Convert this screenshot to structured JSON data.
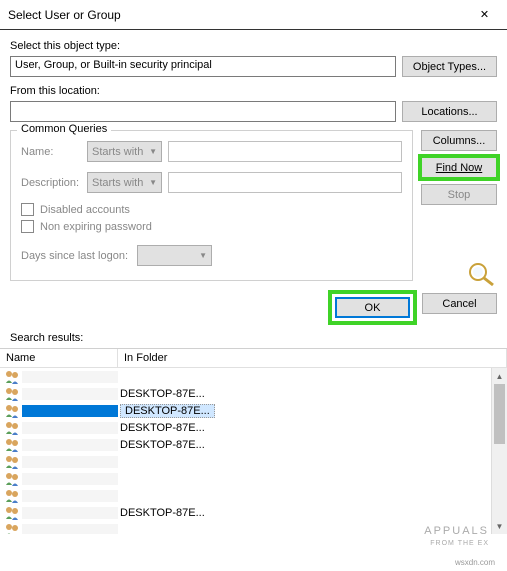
{
  "titlebar": {
    "title": "Select User or Group",
    "close": "✕"
  },
  "object_type": {
    "label": "Select this object type:",
    "value": "User, Group, or Built-in security principal",
    "button": "Object Types..."
  },
  "location": {
    "label": "From this location:",
    "value": "",
    "button": "Locations..."
  },
  "queries": {
    "legend": "Common Queries",
    "name_label": "Name:",
    "desc_label": "Description:",
    "starts_with": "Starts with",
    "disabled": "Disabled accounts",
    "nonexpiring": "Non expiring password",
    "days_label": "Days since last logon:"
  },
  "side": {
    "columns": "Columns...",
    "find_now": "Find Now",
    "stop": "Stop"
  },
  "buttons": {
    "ok": "OK",
    "cancel": "Cancel"
  },
  "results": {
    "label": "Search results:",
    "col_name": "Name",
    "col_folder": "In Folder",
    "items": [
      {
        "folder": ""
      },
      {
        "folder": "DESKTOP-87E..."
      },
      {
        "folder": "DESKTOP-87E...",
        "selected": true
      },
      {
        "folder": "DESKTOP-87E..."
      },
      {
        "folder": "DESKTOP-87E..."
      },
      {
        "folder": ""
      },
      {
        "folder": ""
      },
      {
        "folder": ""
      },
      {
        "folder": "DESKTOP-87E..."
      },
      {
        "folder": ""
      }
    ]
  },
  "watermark": {
    "brand": "APPUALS",
    "tag": "FROM THE EX",
    "site": "wsxdn.com"
  }
}
